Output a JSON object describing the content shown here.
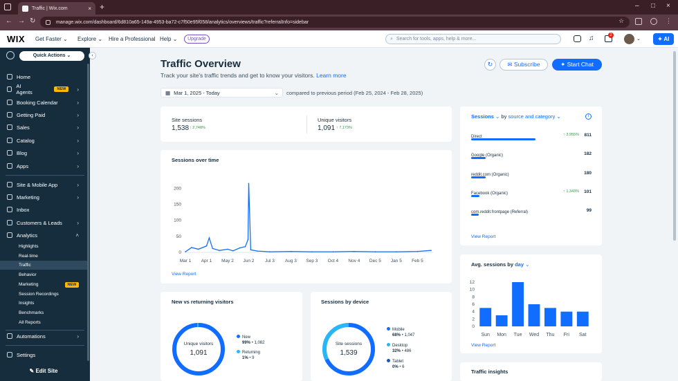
{
  "browser": {
    "tab_title": "Traffic | Wix.com",
    "url": "manage.wix.com/dashboard/6d810a65-149a-4953-ba72-c7f50e95f058/analytics/overviews/traffic?referralInfo=sidebar"
  },
  "header": {
    "logo": "WIX",
    "nav": [
      "Get Faster",
      "Explore",
      "Hire a Professional",
      "Help"
    ],
    "upgrade": "Upgrade",
    "search_placeholder": "Search for tools, apps, help & more...",
    "cart_badge": "2",
    "ai_label": "AI"
  },
  "sidebar": {
    "quick_actions": "Quick Actions",
    "items": [
      {
        "label": "Home"
      },
      {
        "label": "AI Agents",
        "badge": "NEW"
      },
      {
        "label": "Booking Calendar"
      },
      {
        "label": "Getting Paid"
      },
      {
        "label": "Sales"
      },
      {
        "label": "Catalog"
      },
      {
        "label": "Blog"
      },
      {
        "label": "Apps"
      }
    ],
    "items2": [
      {
        "label": "Site & Mobile App"
      },
      {
        "label": "Marketing"
      },
      {
        "label": "Inbox"
      },
      {
        "label": "Customers & Leads"
      },
      {
        "label": "Analytics"
      }
    ],
    "analytics_sub": [
      "Highlights",
      "Real-time",
      "Traffic",
      "Behavior",
      "Marketing",
      "Session Recordings",
      "Insights",
      "Benchmarks",
      "All Reports"
    ],
    "marketing_badge": "NEW",
    "items3": [
      {
        "label": "Automations"
      }
    ],
    "settings": "Settings",
    "edit_site": "Edit Site"
  },
  "main": {
    "title": "Traffic Overview",
    "subtitle": "Track your site's traffic trends and get to know your visitors.",
    "learn_more": "Learn more",
    "subscribe": "Subscribe",
    "start_chat": "Start Chat",
    "date_range": "Mar 1, 2025 - Today",
    "compared": "compared to previous period (Feb 25, 2024 - Feb 28, 2025)"
  },
  "kpis": {
    "site_sessions": {
      "label": "Site sessions",
      "value": "1,538",
      "change": "2,748%"
    },
    "unique_visitors": {
      "label": "Unique visitors",
      "value": "1,091",
      "change": "7,173%"
    }
  },
  "sessions_chart": {
    "title": "Sessions over time",
    "view_report": "View Report",
    "line_color": "#116dff"
  },
  "sources": {
    "metric": "Sessions",
    "by_prefix": "by",
    "by_value": "source and category",
    "view_report": "View Report",
    "rows": [
      {
        "name": "Direct",
        "value": "811",
        "change": "3,955%",
        "fraction": 0.53
      },
      {
        "name": "Google (Organic)",
        "value": "182",
        "change": "",
        "fraction": 0.12
      },
      {
        "name": "reddit.com (Organic)",
        "value": "180",
        "change": "",
        "fraction": 0.12
      },
      {
        "name": "Facebook (Organic)",
        "value": "101",
        "change": "1,343%",
        "fraction": 0.07
      },
      {
        "name": "com.reddit.frontpage (Referral)",
        "value": "99",
        "change": "",
        "fraction": 0.065
      }
    ]
  },
  "avg_sessions": {
    "title": "Avg. sessions by",
    "by_value": "day",
    "view_report": "View Report"
  },
  "new_vs_returning": {
    "title": "New vs returning visitors",
    "center_label": "Unique visitors",
    "center_value": "1,091",
    "legend": [
      {
        "name": "New",
        "pct": "99%",
        "count": "1,082",
        "color": "#116dff"
      },
      {
        "name": "Returning",
        "pct": "1%",
        "count": "9",
        "color": "#29b6f6"
      }
    ]
  },
  "by_device": {
    "title": "Sessions by device",
    "center_label": "Site sessions",
    "center_value": "1,539",
    "legend": [
      {
        "name": "Mobile",
        "pct": "68%",
        "count": "1,047",
        "color": "#116dff"
      },
      {
        "name": "Desktop",
        "pct": "32%",
        "count": "486",
        "color": "#29b6f6"
      },
      {
        "name": "Tablet",
        "pct": "0%",
        "count": "6",
        "color": "#1a55c8"
      }
    ]
  },
  "traffic_insights": {
    "title": "Traffic insights"
  },
  "chart_data": [
    {
      "type": "line",
      "title": "Sessions over time",
      "x_tick_labels": [
        "Mar 1",
        "Apr 1",
        "May 2",
        "Jun 2",
        "Jul 3",
        "Aug 3",
        "Sep 3",
        "Oct 4",
        "Nov 4",
        "Dec 5",
        "Jan 5",
        "Feb 5"
      ],
      "y_ticks": [
        0,
        50,
        100,
        150,
        200
      ],
      "ylim": [
        0,
        220
      ],
      "x": [
        "Mar 1",
        "Mar 10",
        "Mar 20",
        "Apr 1",
        "Apr 5",
        "Apr 10",
        "Apr 20",
        "May 2",
        "May 10",
        "May 20",
        "May 28",
        "Jun 1",
        "Jun 2",
        "Jun 5",
        "Jun 15",
        "Jul 3",
        "Aug 3",
        "Sep 3",
        "Oct 4",
        "Nov 4",
        "Dec 5",
        "Jan 5",
        "Feb 5",
        "Feb 25"
      ],
      "values": [
        2,
        15,
        10,
        20,
        45,
        12,
        6,
        10,
        5,
        14,
        18,
        40,
        215,
        8,
        4,
        2,
        3,
        2,
        2,
        3,
        2,
        2,
        3,
        6
      ]
    },
    {
      "type": "bar",
      "title": "Avg. sessions by day",
      "categories": [
        "Sun",
        "Mon",
        "Tue",
        "Wed",
        "Thu",
        "Fri",
        "Sat"
      ],
      "values": [
        5,
        3,
        12,
        6,
        5,
        4,
        4
      ],
      "y_ticks": [
        0,
        2,
        4,
        6,
        8,
        10,
        12
      ],
      "ylim": [
        0,
        12
      ]
    },
    {
      "type": "pie",
      "title": "New vs returning visitors",
      "categories": [
        "New",
        "Returning"
      ],
      "values": [
        99,
        1
      ]
    },
    {
      "type": "pie",
      "title": "Sessions by device",
      "categories": [
        "Mobile",
        "Desktop",
        "Tablet"
      ],
      "values": [
        68,
        32,
        0
      ]
    }
  ]
}
